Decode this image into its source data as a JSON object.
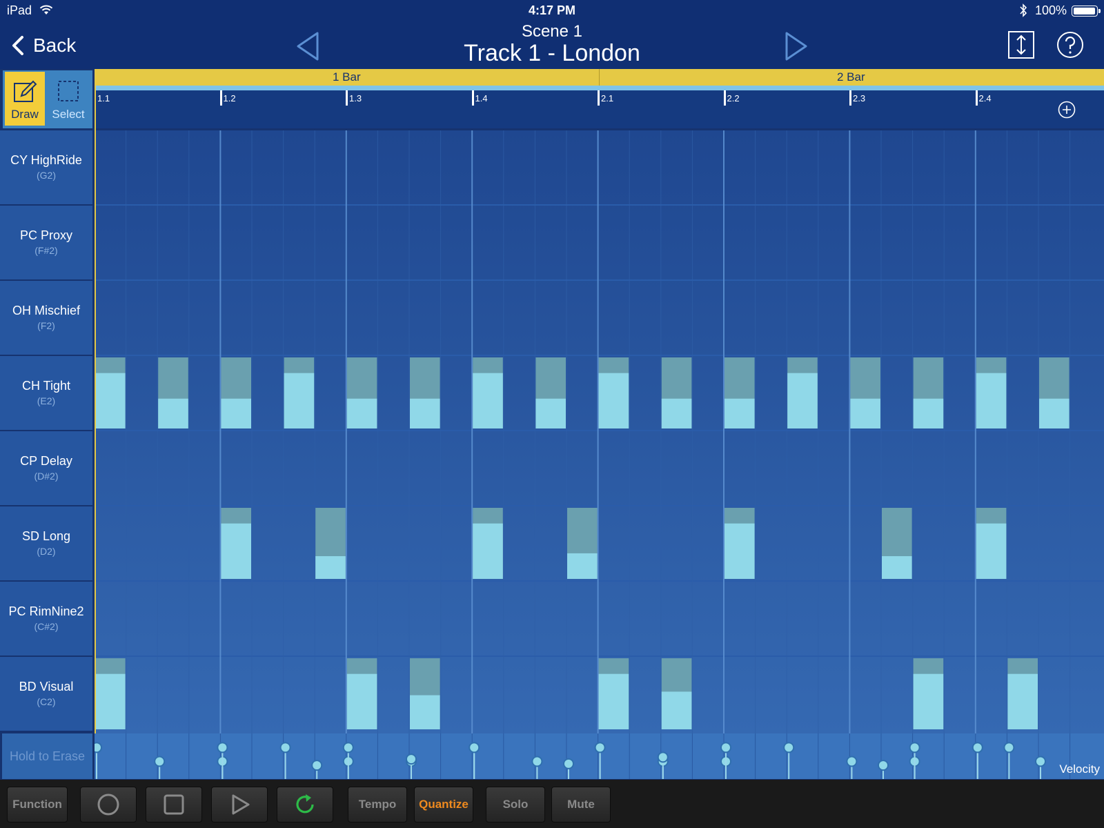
{
  "status_bar": {
    "device": "iPad",
    "time": "4:17 PM",
    "battery_label": "100%",
    "battery_level": 1.0
  },
  "nav": {
    "back_label": "Back",
    "scene": "Scene  1",
    "track": "Track 1 - London",
    "icons": [
      "chevron-left-icon",
      "triangle-left-icon",
      "triangle-right-icon",
      "expand-vertical-icon",
      "help-icon"
    ]
  },
  "tools": {
    "draw_label": "Draw",
    "select_label": "Select",
    "active": "draw"
  },
  "timeline": {
    "bars": [
      "1 Bar",
      "2 Bar"
    ],
    "ticks": [
      "1.1",
      "1.2",
      "1.3",
      "1.4",
      "2.1",
      "2.2",
      "2.3",
      "2.4"
    ],
    "steps_per_row": 32
  },
  "instruments": [
    {
      "name": "CY HighRide",
      "note": "(G2)"
    },
    {
      "name": "PC Proxy",
      "note": "(F#2)"
    },
    {
      "name": "OH Mischief",
      "note": "(F2)"
    },
    {
      "name": "CH Tight",
      "note": "(E2)"
    },
    {
      "name": "CP Delay",
      "note": "(D#2)"
    },
    {
      "name": "SD Long",
      "note": "(D2)"
    },
    {
      "name": "PC RimNine2",
      "note": "(C#2)"
    },
    {
      "name": "BD Visual",
      "note": "(C2)"
    }
  ],
  "notes": [
    {
      "row": 3,
      "step": 0,
      "velocity": 0.78
    },
    {
      "row": 3,
      "step": 2,
      "velocity": 0.42
    },
    {
      "row": 3,
      "step": 4,
      "velocity": 0.42
    },
    {
      "row": 3,
      "step": 6,
      "velocity": 0.78
    },
    {
      "row": 3,
      "step": 8,
      "velocity": 0.42
    },
    {
      "row": 3,
      "step": 10,
      "velocity": 0.42
    },
    {
      "row": 3,
      "step": 12,
      "velocity": 0.78
    },
    {
      "row": 3,
      "step": 14,
      "velocity": 0.42
    },
    {
      "row": 3,
      "step": 16,
      "velocity": 0.78
    },
    {
      "row": 3,
      "step": 18,
      "velocity": 0.42
    },
    {
      "row": 3,
      "step": 20,
      "velocity": 0.42
    },
    {
      "row": 3,
      "step": 22,
      "velocity": 0.78
    },
    {
      "row": 3,
      "step": 24,
      "velocity": 0.42
    },
    {
      "row": 3,
      "step": 26,
      "velocity": 0.42
    },
    {
      "row": 3,
      "step": 28,
      "velocity": 0.78
    },
    {
      "row": 3,
      "step": 30,
      "velocity": 0.42
    },
    {
      "row": 5,
      "step": 4,
      "velocity": 0.78
    },
    {
      "row": 5,
      "step": 7,
      "velocity": 0.32
    },
    {
      "row": 5,
      "step": 12,
      "velocity": 0.78
    },
    {
      "row": 5,
      "step": 15,
      "velocity": 0.36
    },
    {
      "row": 5,
      "step": 20,
      "velocity": 0.78
    },
    {
      "row": 5,
      "step": 25,
      "velocity": 0.32
    },
    {
      "row": 5,
      "step": 28,
      "velocity": 0.78
    },
    {
      "row": 7,
      "step": 0,
      "velocity": 0.78
    },
    {
      "row": 7,
      "step": 8,
      "velocity": 0.78
    },
    {
      "row": 7,
      "step": 10,
      "velocity": 0.48
    },
    {
      "row": 7,
      "step": 16,
      "velocity": 0.78
    },
    {
      "row": 7,
      "step": 18,
      "velocity": 0.53
    },
    {
      "row": 7,
      "step": 26,
      "velocity": 0.78
    },
    {
      "row": 7,
      "step": 29,
      "velocity": 0.78
    }
  ],
  "velocity_lane": {
    "erase_label": "Hold to Erase",
    "label": "Velocity"
  },
  "toolbar": {
    "function_label": "Function",
    "tempo_label": "Tempo",
    "quantize_label": "Quantize",
    "solo_label": "Solo",
    "mute_label": "Mute",
    "icons": [
      "record-icon",
      "stop-icon",
      "play-icon",
      "loop-icon"
    ]
  },
  "colors": {
    "accent_yellow": "#e5c945",
    "note_fill": "#90d8e8",
    "note_cap": "#6aa0af",
    "loop_green": "#2dbb48",
    "quantize_orange": "#ef8a1e"
  }
}
